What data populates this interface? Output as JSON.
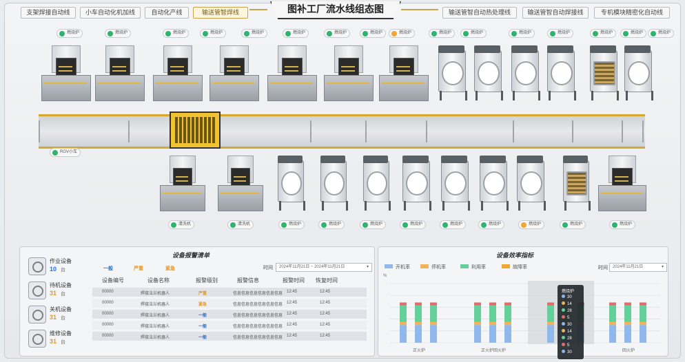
{
  "nav": {
    "left": [
      "支架焊接自动线",
      "小车自动化机加线",
      "自动化产线",
      "输送管智焊线"
    ],
    "right": [
      "输送管智自动热处理线",
      "输送管智自动焊接线",
      "专机模块精密化自动线"
    ],
    "active_index": 3
  },
  "page_title": "图补工厂流水线组态图",
  "top_tags": [
    "燃烧炉",
    "燃烧炉",
    "燃烧炉",
    "燃烧炉",
    "燃烧炉",
    "燃烧炉",
    "燃烧炉",
    "燃烧炉",
    "燃烧炉",
    "燃烧炉",
    "燃烧炉",
    "燃烧炉",
    "燃烧炉",
    "燃烧炉",
    "燃烧炉",
    "燃烧炉"
  ],
  "top_tag_status": [
    "green",
    "green",
    "green",
    "green",
    "green",
    "green",
    "green",
    "green",
    "orange",
    "green",
    "green",
    "green",
    "green",
    "green",
    "green",
    "green"
  ],
  "belt_tag": "RGV小车",
  "bottom_tags": [
    "清洗机",
    "清洗机",
    "燃烧炉",
    "燃烧炉",
    "燃烧炉",
    "燃烧炉",
    "燃烧炉",
    "燃烧炉",
    "燃烧炉",
    "燃烧炉",
    "燃烧炉",
    "燃烧炉"
  ],
  "bottom_tag_status": [
    "green",
    "green",
    "green",
    "green",
    "green",
    "green",
    "green",
    "green",
    "green",
    "orange",
    "green",
    "green"
  ],
  "alarm": {
    "title": "设备报警清单",
    "stats": [
      {
        "label": "作业设备",
        "num": "10",
        "unit": "台"
      },
      {
        "label": "待机设备",
        "num": "31",
        "unit": "台"
      },
      {
        "label": "关机设备",
        "num": "31",
        "unit": "台"
      },
      {
        "label": "维修设备",
        "num": "31",
        "unit": "台"
      }
    ],
    "levels": [
      "一般",
      "严重",
      "紧急"
    ],
    "select_label": "时间",
    "select_value": "2024年11月21日 ~ 2024年11月21日",
    "headers": [
      "设备编号",
      "设备名称",
      "报警级别",
      "报警信息",
      "报警时间",
      "恢复时间"
    ],
    "rows": [
      [
        "00000",
        "焊接法兰机器人",
        "严重",
        "信息信息信息信息信息信息",
        "12:45",
        "12:45"
      ],
      [
        "00000",
        "焊接法兰机器人",
        "紧急",
        "信息信息信息信息信息信息",
        "12:45",
        "12:45"
      ],
      [
        "00000",
        "焊接法兰机器人",
        "一般",
        "信息信息信息信息信息信息",
        "12:45",
        "12:45"
      ],
      [
        "00000",
        "焊接法兰机器人",
        "一般",
        "信息信息信息信息信息信息",
        "12:45",
        "12:45"
      ],
      [
        "00000",
        "焊接法兰机器人",
        "一般",
        "信息信息信息信息信息信息",
        "12:45",
        "12:45"
      ]
    ]
  },
  "efficiency": {
    "title": "设备效率指标",
    "legend": [
      "开机率",
      "停机率",
      "利用率",
      "故障率"
    ],
    "select_label": "时间",
    "select_value": "2024年11月21日",
    "y_unit": "%",
    "group_labels": [
      "正火炉",
      "正火炉回火炉",
      "正火炉",
      "回火炉"
    ],
    "tooltip": {
      "title": "燃烧炉",
      "values": [
        "30",
        "14",
        "28",
        "5",
        "30",
        "14",
        "28",
        "5",
        "30"
      ]
    }
  },
  "colors": {
    "accent": "#c9a34a",
    "run": "#2fb36e",
    "warn": "#f1a533",
    "open": "#8fb8ec",
    "stop": "#f0b25a",
    "use": "#66d09a",
    "fault": "#e36b6b"
  },
  "chart_data": {
    "type": "bar",
    "stacked": true,
    "categories": [
      "正火炉",
      "正火炉回火炉",
      "正火炉",
      "回火炉"
    ],
    "series": [
      {
        "name": "开机率",
        "values": [
          30,
          30,
          30,
          30
        ]
      },
      {
        "name": "停机率",
        "values": [
          5,
          5,
          5,
          5
        ]
      },
      {
        "name": "利用率",
        "values": [
          28,
          28,
          28,
          28
        ]
      },
      {
        "name": "故障率",
        "values": [
          5,
          5,
          5,
          5
        ]
      }
    ],
    "ylabel": "%",
    "ylim": [
      0,
      100
    ]
  }
}
